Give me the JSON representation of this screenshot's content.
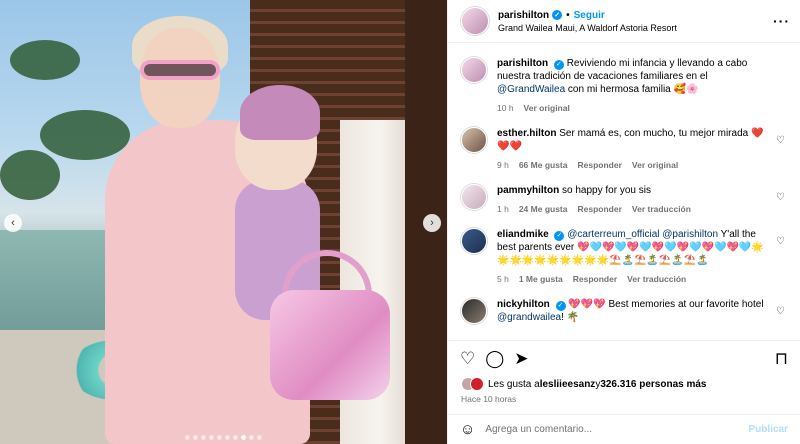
{
  "post": {
    "username": "parishilton",
    "separator": "•",
    "follow_label": "Seguir",
    "location": "Grand Wailea Maui, A Waldorf Astoria Resort",
    "more_icon": "more-horizontal-icon"
  },
  "photo": {
    "prev_icon": "chevron-left-icon",
    "next_icon": "chevron-right-icon",
    "prev_glyph": "‹",
    "next_glyph": "›",
    "dot_count": 10,
    "active_dot": 7
  },
  "caption": {
    "username": "parishilton",
    "text": "Reviviendo mi infancia y llevando a cabo nuestra tradición de vacaciones familiares en el ",
    "mention": "@GrandWailea",
    "text_after": " con mi hermosa familia 🥰🌸",
    "time": "10 h",
    "see_original": "Ver original"
  },
  "comments": [
    {
      "username": "esther.hilton",
      "text": "Ser mamá es, con mucho, tu mejor mirada ❤️❤️❤️",
      "time": "9 h",
      "likes": "66 Me gusta",
      "reply": "Responder",
      "extra": "Ver original"
    },
    {
      "username": "pammyhilton",
      "text": "so happy for you sis",
      "time": "1 h",
      "likes": "24 Me gusta",
      "reply": "Responder",
      "extra": "Ver traducción"
    },
    {
      "username": "eliandmike",
      "mention1": "@carterreum_official",
      "mention2": "@parishilton",
      "text": " Y'all the best parents ever 💖🩵💖🩵💖🩵💖🩵💖🩵💖🩵💖🩵🌟🌟🌟🌟🌟🌟🌟🌟🌟🌟⛱️🏝️⛱️🏝️⛱️🏝️⛱️🏝️",
      "time": "5 h",
      "likes": "1 Me gusta",
      "reply": "Responder",
      "extra": "Ver traducción"
    },
    {
      "username": "nickyhilton",
      "text_before": "💖💖💖 Best memories at our favorite hotel ",
      "mention": "@grandwailea",
      "text_after": "! 🌴"
    }
  ],
  "actions": {
    "like_icon": "heart-icon",
    "comment_icon": "comment-icon",
    "share_icon": "share-icon",
    "save_icon": "bookmark-icon"
  },
  "likes": {
    "prefix": "Les gusta a ",
    "user": "lesliieesanz",
    "middle": " y ",
    "count": "326.316 personas más"
  },
  "posted": "Hace 10 horas",
  "add_comment": {
    "emoji_icon": "smiley-icon",
    "placeholder": "Agrega un comentario...",
    "publish": "Publicar"
  }
}
